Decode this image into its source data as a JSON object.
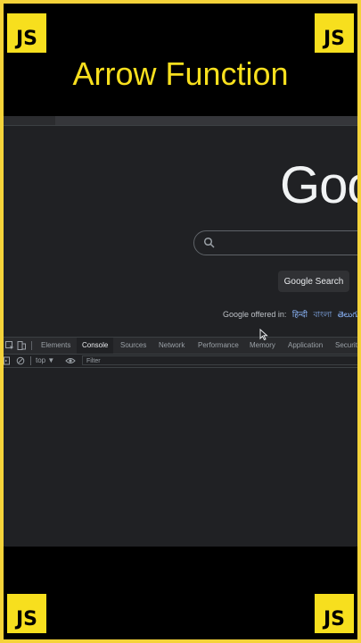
{
  "badge_text": "JS",
  "title": "Arrow Function",
  "google": {
    "logo_text": "Goo",
    "search_button": "Google Search",
    "offered_in": "Google offered in:",
    "languages": [
      "हिन्दी",
      "বাংলা",
      "తెలుగు",
      "म"
    ]
  },
  "devtools": {
    "tabs": [
      "Elements",
      "Console",
      "Sources",
      "Network",
      "Performance",
      "Memory",
      "Application",
      "Securit"
    ],
    "active_tab": "Console",
    "context": "top ▼",
    "filter_placeholder": "Filter"
  },
  "colors": {
    "frame": "#f5d33a",
    "badge": "#f7df1e",
    "title": "#f7df1e",
    "browser_bg": "#202124"
  }
}
